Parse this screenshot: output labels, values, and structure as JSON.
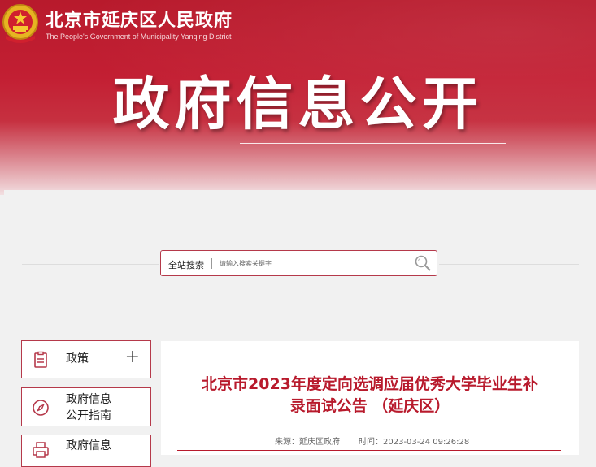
{
  "header": {
    "site_name": "北京市延庆区人民政府",
    "site_name_en": "The People's Government of Municipality Yanqing District",
    "page_title": "政府信息公开"
  },
  "search": {
    "label": "全站搜索",
    "placeholder": "请输入搜索关键字",
    "icon": "search-icon"
  },
  "sidebar": {
    "items": [
      {
        "label_line1": "政策",
        "label_line2": "",
        "icon": "document-icon",
        "expand_icon": "+"
      },
      {
        "label_line1": "政府信息",
        "label_line2": "公开指南",
        "icon": "compass-icon"
      },
      {
        "label_line1": "政府信息",
        "label_line2": "",
        "icon": "printer-icon"
      }
    ]
  },
  "article": {
    "title_line1": "北京市2023年度定向选调应届优秀大学毕业生补",
    "title_line2": "录面试公告 （延庆区）",
    "source": "来源：延庆区政府",
    "time": "时间：2023-03-24 09:26:28"
  },
  "colors": {
    "brand_red": "#b81a2c",
    "border_red": "#b5394a"
  }
}
